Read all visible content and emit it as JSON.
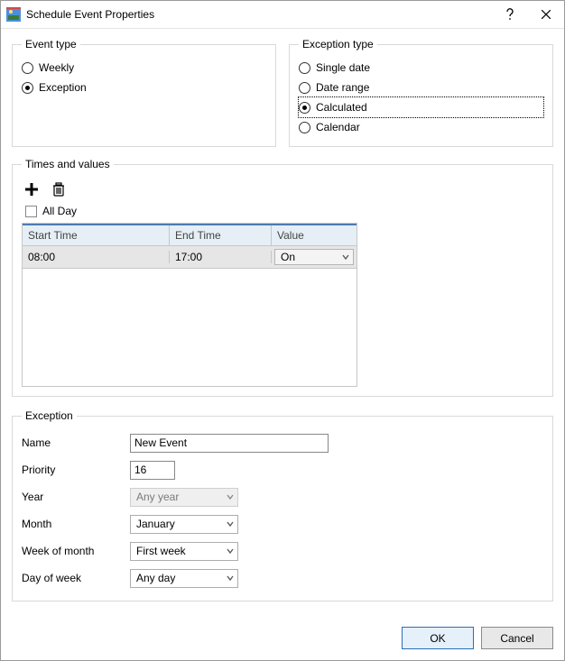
{
  "title": "Schedule Event Properties",
  "event_type": {
    "legend": "Event type",
    "options": [
      {
        "label": "Weekly",
        "selected": false
      },
      {
        "label": "Exception",
        "selected": true
      }
    ]
  },
  "exception_type": {
    "legend": "Exception type",
    "options": [
      {
        "label": "Single date",
        "selected": false
      },
      {
        "label": "Date range",
        "selected": false
      },
      {
        "label": "Calculated",
        "selected": true,
        "focused": true
      },
      {
        "label": "Calendar",
        "selected": false
      }
    ]
  },
  "times": {
    "legend": "Times and values",
    "all_day_label": "All Day",
    "all_day_checked": false,
    "columns": {
      "start": "Start Time",
      "end": "End Time",
      "value": "Value"
    },
    "rows": [
      {
        "start": "08:00",
        "end": "17:00",
        "value": "On"
      }
    ]
  },
  "exception": {
    "legend": "Exception",
    "labels": {
      "name": "Name",
      "priority": "Priority",
      "year": "Year",
      "month": "Month",
      "week": "Week of month",
      "day": "Day of week"
    },
    "values": {
      "name": "New Event",
      "priority": "16",
      "year": "Any year",
      "month": "January",
      "week": "First week",
      "day": "Any day"
    }
  },
  "buttons": {
    "ok": "OK",
    "cancel": "Cancel"
  }
}
